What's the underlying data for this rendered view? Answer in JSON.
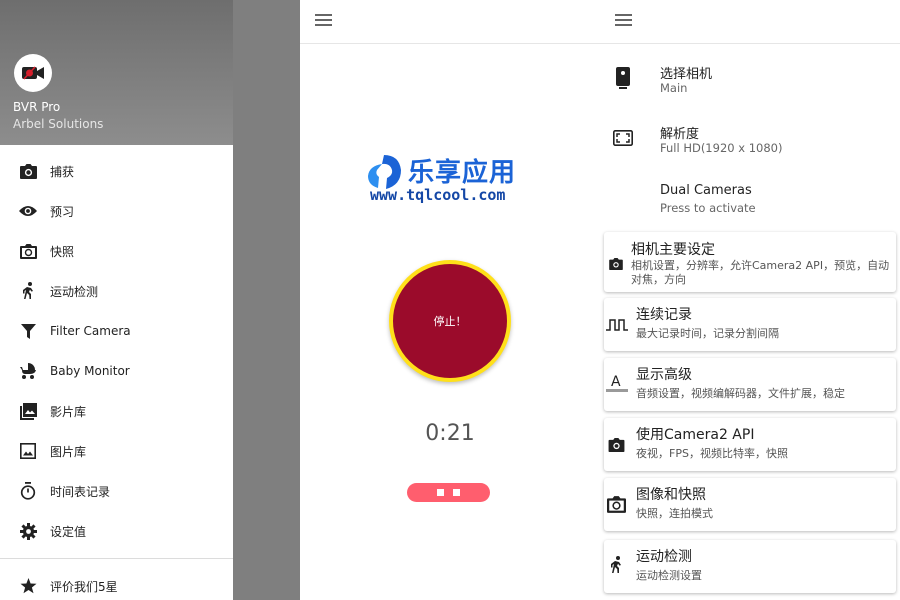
{
  "drawer": {
    "app_name": "BVR Pro",
    "developer": "Arbel Solutions",
    "items": [
      {
        "label": "捕获",
        "icon": "camera-icon"
      },
      {
        "label": "预习",
        "icon": "eye-icon"
      },
      {
        "label": "快照",
        "icon": "snapshot-icon"
      },
      {
        "label": "运动检测",
        "icon": "running-icon"
      },
      {
        "label": "Filter Camera",
        "icon": "filter-icon"
      },
      {
        "label": "Baby Monitor",
        "icon": "stroller-icon"
      },
      {
        "label": "影片库",
        "icon": "video-library-icon"
      },
      {
        "label": "图片库",
        "icon": "image-icon"
      },
      {
        "label": "时间表记录",
        "icon": "timer-icon"
      },
      {
        "label": "设定值",
        "icon": "gear-icon"
      }
    ],
    "footer_item": {
      "label": "评价我们5星",
      "icon": "star-icon"
    }
  },
  "recorder": {
    "watermark_title": "乐享应用",
    "watermark_url": "www.tqlcool.com",
    "stop_label": "停止！",
    "timer": "0:21",
    "colors": {
      "button_fill": "#9b0b2b",
      "button_ring": "#ffe01a",
      "pause": "#ff5e6e"
    }
  },
  "settings": {
    "rows": [
      {
        "title": "选择相机",
        "subtitle": "Main",
        "icon": "phone-camera-icon"
      },
      {
        "title": "解析度",
        "subtitle": "Full HD(1920 x 1080)",
        "icon": "resolution-icon"
      },
      {
        "title": "Dual Cameras",
        "subtitle": "Press to activate",
        "icon": ""
      }
    ],
    "cards": [
      {
        "title": "相机主要设定",
        "subtitle": "相机设置，分辨率，允许Camera2 API，预览，自动对焦，方向",
        "icon": "camera-icon"
      },
      {
        "title": "连续记录",
        "subtitle": "最大记录时间，记录分割间隔",
        "icon": "pulse-wave-icon"
      },
      {
        "title": "显示高级",
        "subtitle": "音频设置，视频编解码器，文件扩展，稳定",
        "icon": "text-format-icon"
      },
      {
        "title": "使用Camera2 API",
        "subtitle": "夜视，FPS，视频比特率，快照",
        "icon": "camera-icon"
      },
      {
        "title": "图像和快照",
        "subtitle": "快照，连拍模式",
        "icon": "snapshot-icon"
      },
      {
        "title": "运动检测",
        "subtitle": "运动检测设置",
        "icon": "running-icon"
      }
    ]
  }
}
